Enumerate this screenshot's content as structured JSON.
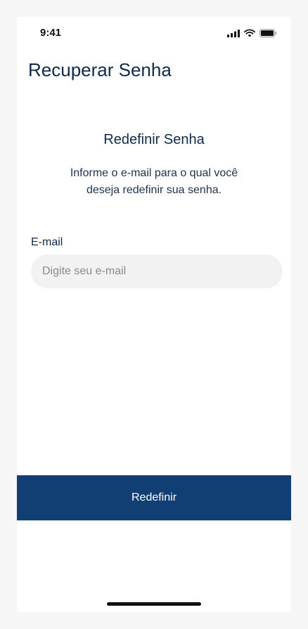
{
  "status_bar": {
    "time": "9:41",
    "icons": [
      "cellular-signal-icon",
      "wifi-icon",
      "battery-icon"
    ]
  },
  "header": {
    "title": "Recuperar Senha"
  },
  "main": {
    "section_title": "Redefinir Senha",
    "description": "Informe o e-mail para o qual você deseja redefinir sua senha.",
    "email_label": "E-mail",
    "email_value": "",
    "email_placeholder": "Digite seu e-mail"
  },
  "actions": {
    "submit_label": "Redefinir"
  },
  "colors": {
    "primary": "#123f73",
    "title_text": "#0f2b4a",
    "input_background": "#f2f2f2"
  }
}
